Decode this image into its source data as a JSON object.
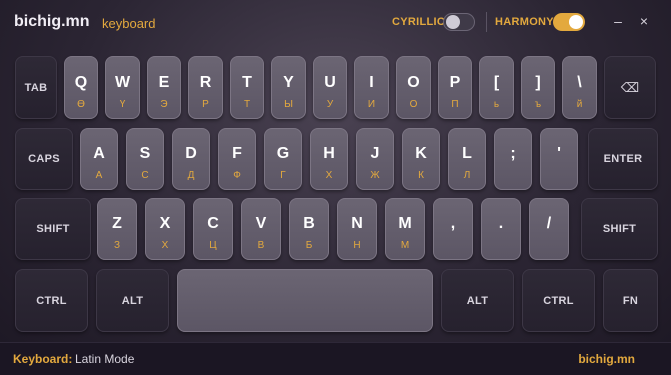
{
  "app": {
    "brand": "bichig.mn",
    "subtitle": "keyboard"
  },
  "toggles": {
    "cyrillic": {
      "label": "CYRILLIC",
      "on": false
    },
    "harmony": {
      "label": "HARMONY",
      "on": true
    }
  },
  "window": {
    "minimize": "–",
    "close": "×"
  },
  "rows": [
    [
      {
        "type": "fn",
        "label": "TAB",
        "name": "tab"
      },
      {
        "main": "Q",
        "sub": "Ө"
      },
      {
        "main": "W",
        "sub": "Ү"
      },
      {
        "main": "E",
        "sub": "Э"
      },
      {
        "main": "R",
        "sub": "Р"
      },
      {
        "main": "T",
        "sub": "Т"
      },
      {
        "main": "Y",
        "sub": "Ы"
      },
      {
        "main": "U",
        "sub": "У"
      },
      {
        "main": "I",
        "sub": "И"
      },
      {
        "main": "O",
        "sub": "О"
      },
      {
        "main": "P",
        "sub": "П"
      },
      {
        "main": "[",
        "sub": "ь"
      },
      {
        "main": "]",
        "sub": "ъ"
      },
      {
        "main": "\\",
        "sub": "й"
      },
      {
        "type": "icon",
        "label": "⌫",
        "name": "backspace"
      }
    ],
    [
      {
        "type": "fn",
        "label": "CAPS",
        "name": "caps"
      },
      {
        "main": "A",
        "sub": "А"
      },
      {
        "main": "S",
        "sub": "С"
      },
      {
        "main": "D",
        "sub": "Д"
      },
      {
        "main": "F",
        "sub": "Ф"
      },
      {
        "main": "G",
        "sub": "Г"
      },
      {
        "main": "H",
        "sub": "Х"
      },
      {
        "main": "J",
        "sub": "Ж"
      },
      {
        "main": "K",
        "sub": "К"
      },
      {
        "main": "L",
        "sub": "Л"
      },
      {
        "main": ";",
        "sub": ""
      },
      {
        "main": "'",
        "sub": ""
      },
      {
        "type": "fn",
        "label": "ENTER",
        "name": "enter"
      }
    ],
    [
      {
        "type": "fn",
        "label": "SHIFT",
        "name": "shift-left"
      },
      {
        "main": "Z",
        "sub": "З"
      },
      {
        "main": "X",
        "sub": "Х"
      },
      {
        "main": "C",
        "sub": "Ц"
      },
      {
        "main": "V",
        "sub": "В"
      },
      {
        "main": "B",
        "sub": "Б"
      },
      {
        "main": "N",
        "sub": "Н"
      },
      {
        "main": "M",
        "sub": "М"
      },
      {
        "main": ",",
        "sub": ""
      },
      {
        "main": ".",
        "sub": ""
      },
      {
        "main": "/",
        "sub": ""
      },
      {
        "type": "fn",
        "label": "SHIFT",
        "name": "shift-right"
      }
    ],
    [
      {
        "type": "fn",
        "label": "CTRL",
        "name": "ctrl-left"
      },
      {
        "type": "fn",
        "label": "ALT",
        "name": "alt-left"
      },
      {
        "type": "space",
        "label": "",
        "name": "space"
      },
      {
        "type": "fn",
        "label": "ALT",
        "name": "alt-right"
      },
      {
        "type": "fn",
        "label": "CTRL",
        "name": "ctrl-right"
      },
      {
        "type": "fn",
        "label": "FN",
        "name": "fn"
      }
    ]
  ],
  "status": {
    "label": "Keyboard:",
    "value": "Latin Mode",
    "brand": "bichig.mn"
  },
  "colors": {
    "accent": "#e3a93e",
    "background": "#2b2533",
    "statusbar": "#1b1623"
  }
}
